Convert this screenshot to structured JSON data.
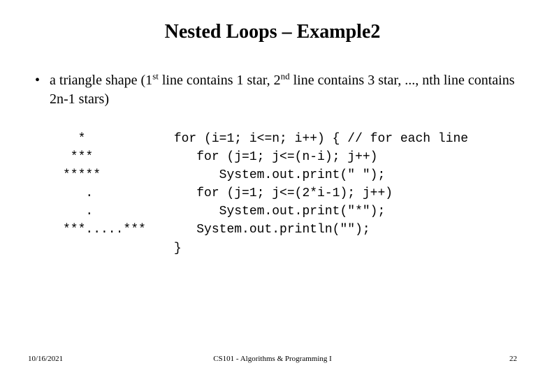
{
  "title": "Nested Loops – Example2",
  "bullet": {
    "pre1": "a triangle shape (1",
    "sup1": "st",
    "mid1": " line contains 1 star, 2",
    "sup2": "nd",
    "post": " line contains 3 star, ..., nth line contains 2n-1 stars)"
  },
  "shape": "  *\n ***\n*****\n   .\n   .\n***.....***",
  "code": "for (i=1; i<=n; i++) { // for each line\n   for (j=1; j<=(n-i); j++)\n      System.out.print(\" \");\n   for (j=1; j<=(2*i-1); j++)\n      System.out.print(\"*\");\n   System.out.println(\"\");\n}",
  "footer": {
    "date": "10/16/2021",
    "course": "CS101 - Algorithms & Programming I",
    "page": "22"
  }
}
